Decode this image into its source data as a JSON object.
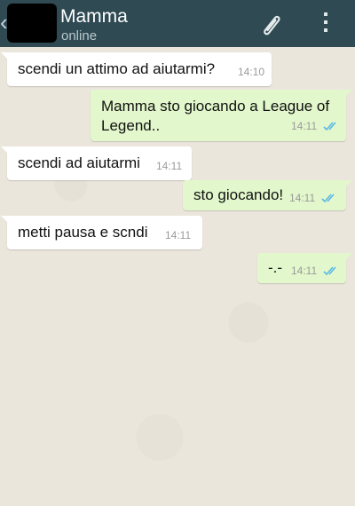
{
  "header": {
    "back_glyph": "‹",
    "contact_name": "Mamma",
    "status": "online"
  },
  "icons": {
    "attach": "paperclip-icon",
    "menu": "overflow-menu-icon"
  },
  "colors": {
    "header_bg": "#2f4a53",
    "chat_bg": "#ebe6dc",
    "incoming_bubble": "#ffffff",
    "outgoing_bubble": "#e2f7cb",
    "read_ticks": "#5ab8e8"
  },
  "messages": [
    {
      "direction": "in",
      "text": "scendi un attimo ad aiutarmi?",
      "time": "14:10"
    },
    {
      "direction": "out",
      "text": "Mamma sto giocando a League of Legend..",
      "time": "14:11",
      "read": true
    },
    {
      "direction": "in",
      "text": "scendi ad aiutarmi",
      "time": "14:11"
    },
    {
      "direction": "out",
      "text": "sto giocando!",
      "time": "14:11",
      "read": true
    },
    {
      "direction": "in",
      "text": "metti pausa e scndi",
      "time": "14:11"
    },
    {
      "direction": "out",
      "text": "-.-",
      "time": "14:11",
      "read": true
    }
  ]
}
